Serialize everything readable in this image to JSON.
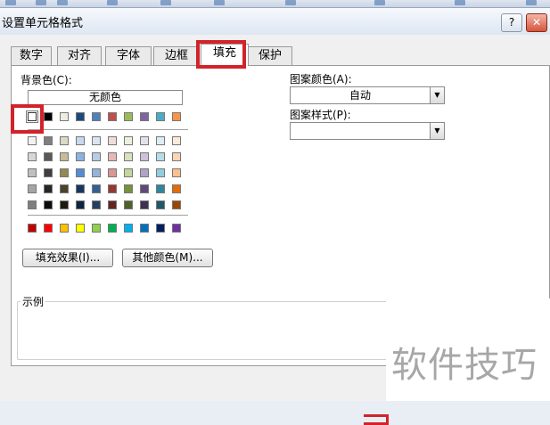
{
  "window": {
    "title": "设置单元格格式",
    "help_glyph": "?",
    "close_glyph": "✕"
  },
  "tabs": [
    {
      "label": "数字"
    },
    {
      "label": "对齐"
    },
    {
      "label": "字体"
    },
    {
      "label": "边框"
    },
    {
      "label": "填充",
      "active": true
    },
    {
      "label": "保护"
    }
  ],
  "fill": {
    "background_label": "背景色(C):",
    "no_color_label": "无颜色",
    "row1_colors": [
      "#ffffff",
      "#000000",
      "#eeece1",
      "#1f497d",
      "#4f81bd",
      "#c0504d",
      "#9bbb59",
      "#8064a2",
      "#4bacc6",
      "#f79646"
    ],
    "tint_rows": [
      [
        "#f2f2f2",
        "#7f7f7f",
        "#ddd9c3",
        "#c6d9f0",
        "#dbe5f1",
        "#f2dcdb",
        "#ebf1dd",
        "#e5e0ec",
        "#dbeef3",
        "#fdeada"
      ],
      [
        "#d8d8d8",
        "#595959",
        "#c4bd97",
        "#8db3e2",
        "#b8cce4",
        "#e5b9b7",
        "#d7e3bc",
        "#ccc1d9",
        "#b7dde8",
        "#fbd5b5"
      ],
      [
        "#bfbfbf",
        "#3f3f3f",
        "#938953",
        "#548dd4",
        "#95b3d7",
        "#d99694",
        "#c3d69b",
        "#b2a2c7",
        "#92cddc",
        "#fac08f"
      ],
      [
        "#a5a5a5",
        "#262626",
        "#494429",
        "#17365d",
        "#366092",
        "#953734",
        "#76923c",
        "#5f497a",
        "#31859b",
        "#e36c09"
      ],
      [
        "#7f7f7f",
        "#0c0c0c",
        "#1d1b10",
        "#0f243e",
        "#244061",
        "#632423",
        "#4f6128",
        "#3f3151",
        "#205867",
        "#974806"
      ]
    ],
    "standard_colors": [
      "#c00000",
      "#ff0000",
      "#ffc000",
      "#ffff00",
      "#92d050",
      "#00b050",
      "#00b0f0",
      "#0070c0",
      "#002060",
      "#7030a0"
    ],
    "fill_effects_label": "填充效果(I)...",
    "more_colors_label": "其他颜色(M)...",
    "pattern_color_label": "图案颜色(A):",
    "pattern_color_value": "自动",
    "pattern_style_label": "图案样式(P):",
    "pattern_style_value": "",
    "sample_label": "示例"
  },
  "watermark": {
    "text": "软件技巧"
  },
  "highlight_color": "#d2232a"
}
